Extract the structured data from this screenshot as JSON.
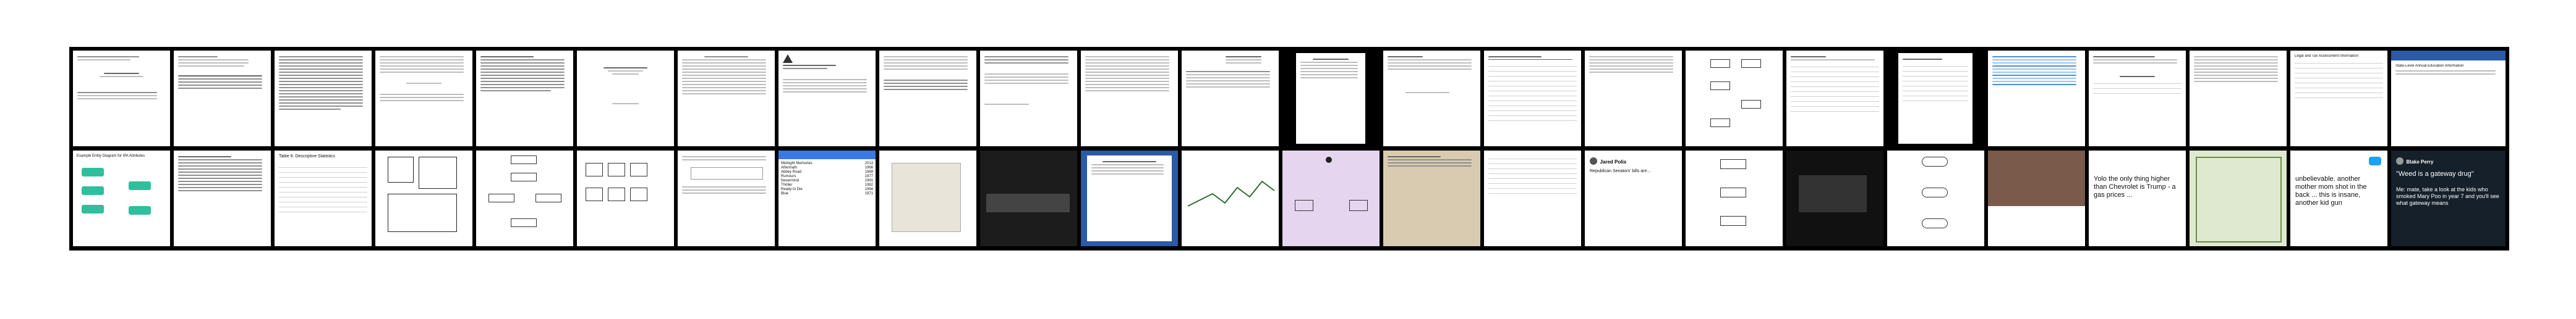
{
  "grid": {
    "title": "",
    "tiles_top_count": 24,
    "tiles_bottom_count": 24
  },
  "tiles": {
    "b2_title": "Example Entity Diagram for IPA Attributes",
    "b3_title": "Table 6: Descriptive Statistics",
    "b8_headers": [
      "Title",
      "Artist",
      "Year",
      "Length",
      "Genre"
    ],
    "b8_rows": [
      [
        "Midnight Memories",
        "2013",
        "55:13",
        "Pop",
        "Pop"
      ],
      [
        "Aftermath",
        "1966",
        "42:50",
        "Rock",
        "Rock"
      ],
      [
        "Abbey Road",
        "1969",
        "47:23",
        "Rock",
        "Rock"
      ],
      [
        "Rumours",
        "1977",
        "39:43",
        "Rock",
        "Rock"
      ],
      [
        "Nevermind",
        "1991",
        "49:23",
        "Grunge",
        "Grunge"
      ],
      [
        "Thriller",
        "1982",
        "42:19",
        "Pop",
        "Pop"
      ],
      [
        "Ready to Die",
        "1994",
        "69:42",
        "Hip-hop",
        "Hip-hop"
      ],
      [
        "Blue",
        "1971",
        "35:41",
        "Folk",
        "Folk"
      ]
    ],
    "b16_name": "Jared Polis",
    "b16_tweet": "Republican Senators' bills are...",
    "b20_tweet": "Yolo the only thing higher than Chevrolet is Trump - a gas prices ...",
    "b22_tweet": "unbelievable. another mother mom shot in the back ... this is insane, another kid gun",
    "b24_name": "Blake Perry",
    "b24_quote": "\"Weed is a gateway drug\"",
    "b24_tweet": "Me: mate, take a look at the kids who smoked Mary Poo in year 7 and you'll see what gateway means",
    "t24_header": "State-Level Annual Education Information",
    "t23_header": "Legal and Tax Assessment Information"
  },
  "colors": {
    "frame": "#000000",
    "accent_green": "#2fbf9c",
    "accent_blue": "#2b5aa8",
    "twitter_blue": "#1da1f2",
    "lilac": "#e6d5ef"
  }
}
